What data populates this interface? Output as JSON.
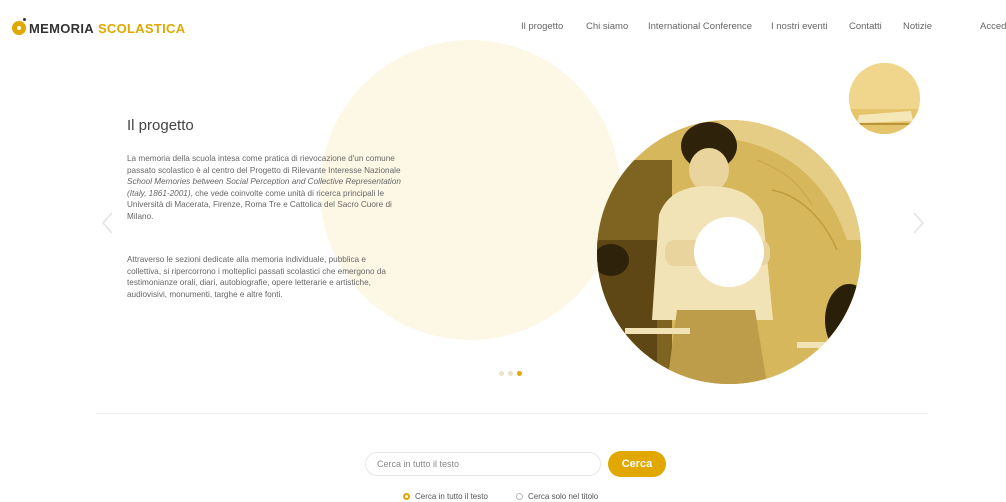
{
  "brand": {
    "logo_word1": "MEMORIA",
    "logo_word2": "SCOLASTICA",
    "accent_color": "#e0a800"
  },
  "nav": {
    "items": [
      "Il progetto",
      "Chi siamo",
      "International Conference",
      "I nostri eventi",
      "Contatti",
      "Notizie",
      "Accedi"
    ]
  },
  "hero": {
    "title": "Il progetto",
    "p1_a": "La memoria della scuola intesa come pratica di rievocazione d'un comune passato scolastico è al centro del Progetto di Rilevante Interesse Nazionale ",
    "p1_em": "School Memories between Social Perception and Collective Representation (Italy, 1861-2001)",
    "p1_b": ", che vede coinvolte come unità di ricerca principali le Università di Macerata, Firenze, Roma Tre e Cattolica del Sacro Cuore di Milano.",
    "p2": "Attraverso le sezioni dedicate alla memoria individuale, pubblica e collettiva, si ripercorrono i molteplici passati scolastici che emergono da testimonianze orali, diari, autobiografie, opere letterarie e artistiche, audiovisivi, monumenti, targhe e altre fonti.",
    "slides_count": 3,
    "active_slide": 3,
    "prev_icon": "chevron-left-icon",
    "next_icon": "chevron-right-icon"
  },
  "search": {
    "placeholder": "Cerca in tutto il testo",
    "button_label": "Cerca",
    "options": [
      {
        "label": "Cerca in tutto il testo",
        "checked": true
      },
      {
        "label": "Cerca solo nel titolo",
        "checked": false
      }
    ]
  }
}
